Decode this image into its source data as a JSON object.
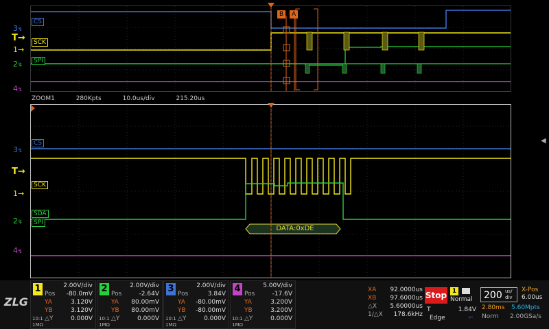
{
  "main_pane": {
    "markers": {
      "b": "B",
      "a": "A"
    },
    "labels": {
      "cs": "CS",
      "sck": "SCK",
      "spi": "SPI"
    }
  },
  "left_markers": {
    "ch3": "3",
    "trig": "T",
    "ch1": "1",
    "ch2": "2",
    "ch4": "4"
  },
  "zoom_bar": {
    "label": "ZOOM1",
    "points": "280Kpts",
    "timebase": "10.0us/div",
    "position": "215.20us"
  },
  "zoom_pane": {
    "labels": {
      "cs": "CS",
      "sck": "SCK",
      "sda": "SDA",
      "spi": "SPI"
    },
    "decode": "DATA:0xDE"
  },
  "channels": [
    {
      "num": "1",
      "color": "#f2e81a",
      "scale": "2.00V/div",
      "pos_label": "Pos",
      "pos": "-80.0mV",
      "ya_label": "YA",
      "ya": "3.120V",
      "yb_label": "YB",
      "yb": "3.120V",
      "dy_label": "△Y",
      "dy": "0.000V",
      "coupling": "10:1",
      "imp": "1MΩ"
    },
    {
      "num": "2",
      "color": "#27d13b",
      "scale": "2.00V/div",
      "pos_label": "Pos",
      "pos": "-2.64V",
      "ya_label": "YA",
      "ya": "80.00mV",
      "yb_label": "YB",
      "yb": "80.00mV",
      "dy_label": "△Y",
      "dy": "0.000V",
      "coupling": "10:1",
      "imp": "1MΩ"
    },
    {
      "num": "3",
      "color": "#3d73d8",
      "scale": "2.00V/div",
      "pos_label": "Pos",
      "pos": "3.84V",
      "ya_label": "YA",
      "ya": "-80.00mV",
      "yb_label": "YB",
      "yb": "-80.00mV",
      "dy_label": "△Y",
      "dy": "0.000V",
      "coupling": "10:1",
      "imp": "1MΩ"
    },
    {
      "num": "4",
      "color": "#c444c8",
      "scale": "5.00V/div",
      "pos_label": "Pos",
      "pos": "-17.6V",
      "ya_label": "YA",
      "ya": "3.200V",
      "yb_label": "YB",
      "yb": "3.200V",
      "dy_label": "△Y",
      "dy": "0.000V",
      "coupling": "10:1",
      "imp": "1MΩ"
    }
  ],
  "cursors": {
    "xa_label": "XA",
    "xa": "92.0000us",
    "xb_label": "XB",
    "xb": "97.6000us",
    "dx_label": "△X",
    "dx": "5.60000us",
    "inv_label": "1/△X",
    "inv": "178.6kHz"
  },
  "run": {
    "stop": "Stop"
  },
  "trigger": {
    "source": "1",
    "mode": "Normal",
    "label": "T",
    "level": "1.84V",
    "type": "Edge"
  },
  "timebase": {
    "value": "200",
    "unit_top": "us/",
    "unit_bot": "div",
    "xpos_label": "X-Pos",
    "xpos": "6.00us",
    "record_time": "2.80ms",
    "record_pts": "5.60Mpts",
    "acq_mode": "Norm",
    "sample_rate": "2.00GSa/s"
  },
  "logo": "ZLG"
}
